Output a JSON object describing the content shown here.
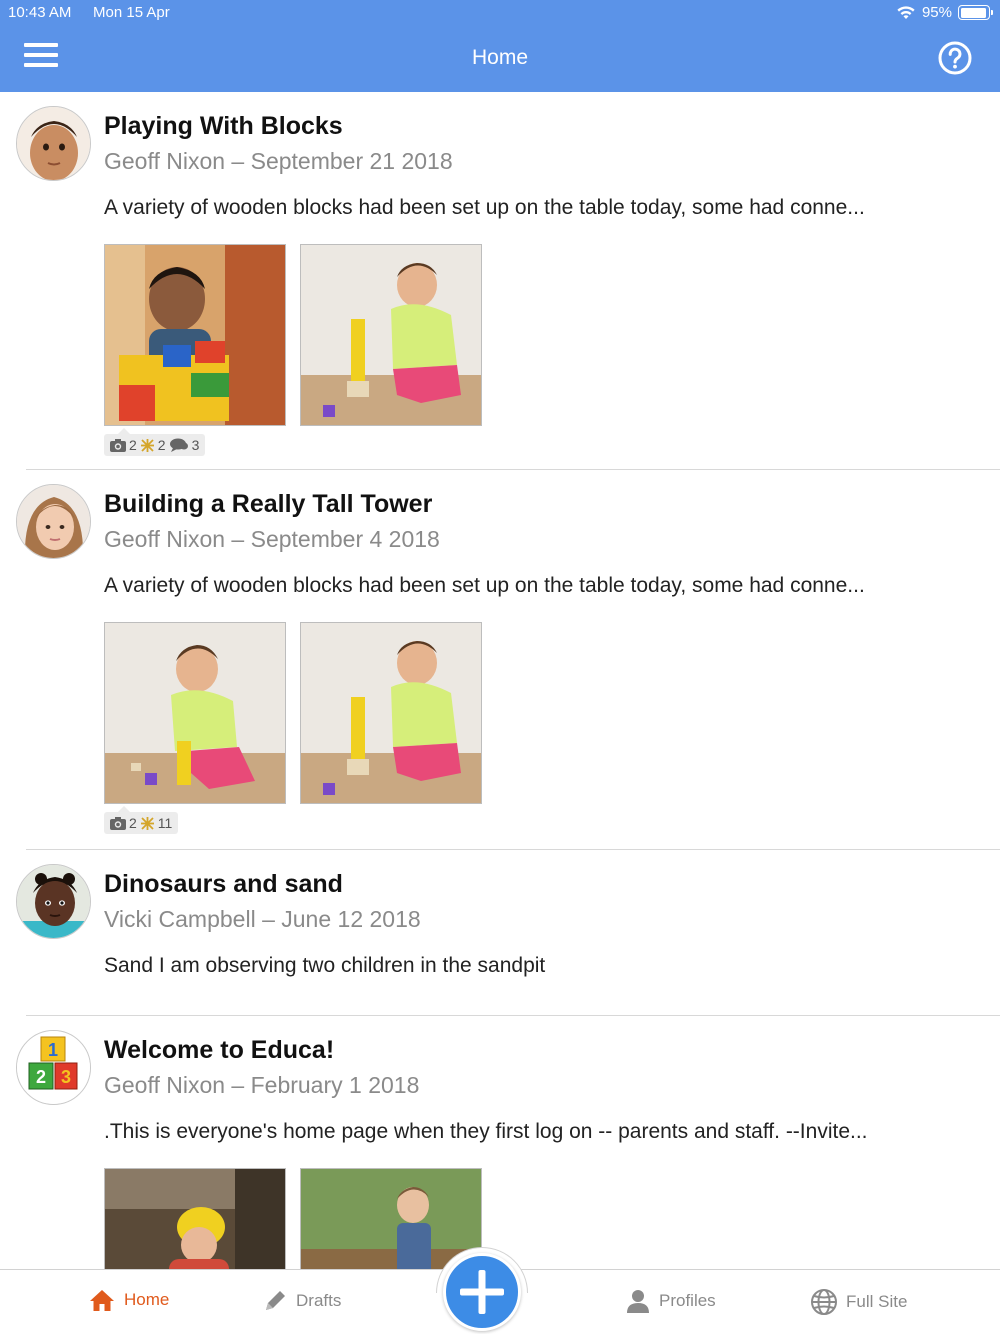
{
  "status_bar": {
    "time": "10:43 AM",
    "date": "Mon 15 Apr",
    "battery": "95%"
  },
  "header": {
    "title": "Home",
    "accent_color": "#5b93e8"
  },
  "posts": [
    {
      "title": "Playing With Blocks",
      "meta": "Geoff Nixon – September 21 2018",
      "excerpt": "A variety of wooden blocks had been set up on the table today, some had conne...",
      "stats": {
        "photos": "2",
        "learning": "2",
        "comments": "3"
      }
    },
    {
      "title": "Building a Really Tall Tower",
      "meta": "Geoff Nixon – September 4 2018",
      "excerpt": "A variety of wooden blocks had been set up on the table today, some had conne...",
      "stats": {
        "photos": "2",
        "learning": "11"
      }
    },
    {
      "title": "Dinosaurs and sand",
      "meta": "Vicki Campbell – June 12 2018",
      "excerpt": "Sand I am observing two children in the sandpit"
    },
    {
      "title": "Welcome to Educa!",
      "meta": "Geoff Nixon – February 1 2018",
      "excerpt": ".This is everyone's home page when they first log on -- parents and staff. --Invite..."
    }
  ],
  "tabs": {
    "home": "Home",
    "drafts": "Drafts",
    "profiles": "Profiles",
    "full_site": "Full Site",
    "active_color": "#e05a1c",
    "fab_color": "#3d8ce6"
  },
  "icons": [
    "menu-icon",
    "help-icon",
    "wifi-icon",
    "battery-icon",
    "camera-icon",
    "learning-icon",
    "comment-icon",
    "home-icon",
    "pencil-icon",
    "add-icon",
    "person-icon",
    "globe-icon"
  ]
}
